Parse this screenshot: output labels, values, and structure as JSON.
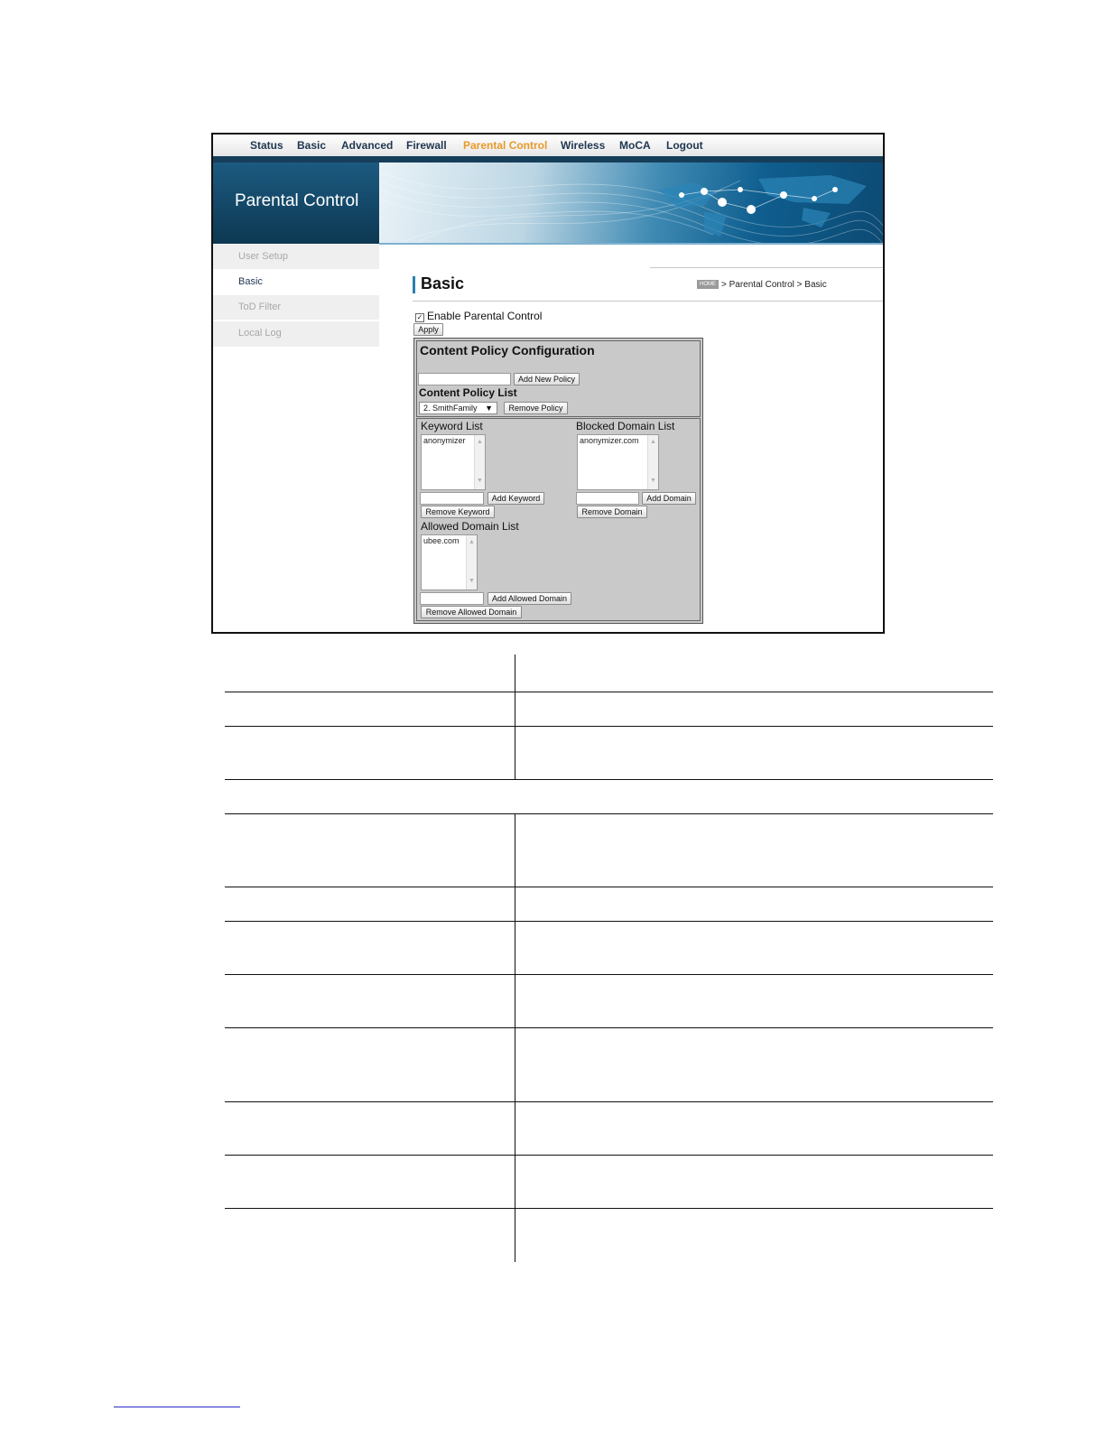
{
  "nav": {
    "items": [
      {
        "label": "Status"
      },
      {
        "label": "Basic"
      },
      {
        "label": "Advanced"
      },
      {
        "label": "Firewall"
      },
      {
        "label": "Parental Control",
        "active": true
      },
      {
        "label": "Wireless"
      },
      {
        "label": "MoCA"
      },
      {
        "label": "Logout"
      }
    ],
    "active_color": "#e89a2a",
    "text_color": "#1f3650"
  },
  "banner": {
    "title": "Parental Control",
    "background_color": "#0d3852"
  },
  "sidebar": {
    "items": [
      {
        "label": "User Setup"
      },
      {
        "label": "Basic",
        "active": true
      },
      {
        "label": "ToD Filter"
      },
      {
        "label": "Local Log"
      }
    ]
  },
  "page": {
    "title": "Basic",
    "breadcrumb": {
      "home": "HOME",
      "path": "> Parental Control > Basic"
    }
  },
  "enable": {
    "label": "Enable Parental Control",
    "checked": true,
    "apply_label": "Apply"
  },
  "policy": {
    "heading": "Content Policy Configuration",
    "new_policy_value": "",
    "add_label": "Add New Policy",
    "list_heading": "Content Policy List",
    "selected": "2. SmithFamily",
    "remove_label": "Remove Policy"
  },
  "keyword": {
    "label": "Keyword List",
    "items": [
      "anonymizer"
    ],
    "input_value": "",
    "add_label": "Add Keyword",
    "remove_label": "Remove Keyword"
  },
  "blocked": {
    "label": "Blocked Domain List",
    "items": [
      "anonymizer.com"
    ],
    "input_value": "",
    "add_label": "Add Domain",
    "remove_label": "Remove Domain"
  },
  "allowed": {
    "label": "Allowed Domain List",
    "items": [
      "ubee.com"
    ],
    "input_value": "",
    "add_label": "Add Allowed Domain",
    "remove_label": "Remove Allowed Domain"
  }
}
